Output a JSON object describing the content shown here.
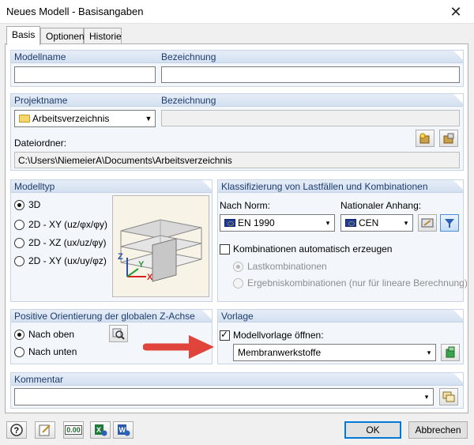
{
  "window": {
    "title": "Neues Modell - Basisangaben",
    "close": "✕"
  },
  "tabs": [
    {
      "label": "Basis"
    },
    {
      "label": "Optionen"
    },
    {
      "label": "Historie"
    }
  ],
  "modell": {
    "name_label": "Modellname",
    "desc_label": "Bezeichnung",
    "name_value": "",
    "desc_value": ""
  },
  "projekt": {
    "name_label": "Projektname",
    "desc_label": "Bezeichnung",
    "selected": "Arbeitsverzeichnis",
    "desc_value": "",
    "folder_label": "Dateiordner:",
    "folder_value": "C:\\Users\\NiemeierA\\Documents\\Arbeitsverzeichnis"
  },
  "modelltyp": {
    "title": "Modelltyp",
    "options": [
      {
        "label": "3D",
        "selected": true
      },
      {
        "label": "2D - XY (uz/φx/φy)",
        "selected": false
      },
      {
        "label": "2D - XZ (ux/uz/φy)",
        "selected": false
      },
      {
        "label": "2D - XY (ux/uy/φz)",
        "selected": false
      }
    ],
    "axes": {
      "z": "Z",
      "y": "Y",
      "x": "X"
    }
  },
  "klassifizierung": {
    "title": "Klassifizierung von Lastfällen und Kombinationen",
    "norm_label": "Nach Norm:",
    "norm_value": "EN 1990",
    "anhang_label": "Nationaler Anhang:",
    "anhang_value": "CEN",
    "auto_label": "Kombinationen automatisch erzeugen",
    "auto_checked": false,
    "options": [
      {
        "label": "Lastkombinationen",
        "selected": true
      },
      {
        "label": "Ergebniskombinationen (nur für lineare Berechnung)",
        "selected": false
      }
    ]
  },
  "orientierung": {
    "title": "Positive Orientierung der globalen Z-Achse",
    "options": [
      {
        "label": "Nach oben",
        "selected": true
      },
      {
        "label": "Nach unten",
        "selected": false
      }
    ]
  },
  "vorlage": {
    "title": "Vorlage",
    "open_label": "Modellvorlage öffnen:",
    "open_checked": true,
    "selected": "Membranwerkstoffe"
  },
  "kommentar": {
    "title": "Kommentar",
    "value": ""
  },
  "footer": {
    "ok": "OK",
    "cancel": "Abbrechen",
    "units_icon_text": "0.00"
  },
  "colors": {
    "accent": "#0078d7",
    "arrow": "#e0443a",
    "group_header": "#d4e0f0",
    "label": "#1e3c6e"
  }
}
